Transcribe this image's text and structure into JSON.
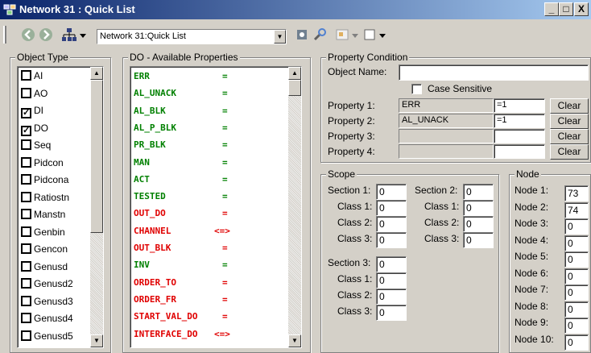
{
  "window": {
    "title": "Network 31 : Quick List",
    "minimize": "_",
    "maximize": "□",
    "close": "X"
  },
  "toolbar": {
    "combo_value": "Network 31:Quick List",
    "icons": [
      "back-icon",
      "forward-icon",
      "tree-icon",
      "dropdown-icon",
      "object-icon",
      "tool-icon",
      "page-icon",
      "window-icon"
    ]
  },
  "object_type": {
    "legend": "Object Type",
    "items": [
      {
        "label": "AI",
        "checked": false
      },
      {
        "label": "AO",
        "checked": false
      },
      {
        "label": "DI",
        "checked": true
      },
      {
        "label": "DO",
        "checked": true
      },
      {
        "label": "Seq",
        "checked": false
      },
      {
        "label": "Pidcon",
        "checked": false
      },
      {
        "label": "Pidcona",
        "checked": false
      },
      {
        "label": "Ratiostn",
        "checked": false
      },
      {
        "label": "Manstn",
        "checked": false
      },
      {
        "label": "Genbin",
        "checked": false
      },
      {
        "label": "Gencon",
        "checked": false
      },
      {
        "label": "Genusd",
        "checked": false
      },
      {
        "label": "Genusd2",
        "checked": false
      },
      {
        "label": "Genusd3",
        "checked": false
      },
      {
        "label": "Genusd4",
        "checked": false
      },
      {
        "label": "Genusd5",
        "checked": false
      }
    ],
    "check_mark": "✓"
  },
  "properties": {
    "legend": "DO - Available Properties",
    "colors": {
      "green": "#008000",
      "red": "#e00000"
    },
    "items": [
      {
        "name": "ERR",
        "op": "=",
        "color": "green"
      },
      {
        "name": "AL_UNACK",
        "op": "=",
        "color": "green"
      },
      {
        "name": "AL_BLK",
        "op": "=",
        "color": "green"
      },
      {
        "name": "AL_P_BLK",
        "op": "=",
        "color": "green"
      },
      {
        "name": "PR_BLK",
        "op": "=",
        "color": "green"
      },
      {
        "name": "MAN",
        "op": "=",
        "color": "green"
      },
      {
        "name": "ACT",
        "op": "=",
        "color": "green"
      },
      {
        "name": "TESTED",
        "op": "=",
        "color": "green"
      },
      {
        "name": "OUT_DO",
        "op": "=",
        "color": "red"
      },
      {
        "name": "CHANNEL",
        "op": "<=>",
        "color": "red"
      },
      {
        "name": "OUT_BLK",
        "op": "=",
        "color": "red"
      },
      {
        "name": "INV",
        "op": "=",
        "color": "green"
      },
      {
        "name": "ORDER_TO",
        "op": "=",
        "color": "red"
      },
      {
        "name": "ORDER_FR",
        "op": "=",
        "color": "red"
      },
      {
        "name": "START_VAL_DO",
        "op": "=",
        "color": "red"
      },
      {
        "name": "INTERFACE_DO",
        "op": "<=>",
        "color": "red"
      }
    ]
  },
  "condition": {
    "legend": "Property Condition",
    "object_name_label": "Object Name:",
    "object_name_value": "",
    "case_sensitive_label": "Case Sensitive",
    "clear_label": "Clear",
    "rows": [
      {
        "label": "Property 1:",
        "name": "ERR",
        "value": "=1"
      },
      {
        "label": "Property 2:",
        "name": "AL_UNACK",
        "value": "=1"
      },
      {
        "label": "Property 3:",
        "name": "",
        "value": ""
      },
      {
        "label": "Property 4:",
        "name": "",
        "value": ""
      }
    ]
  },
  "scope": {
    "legend": "Scope",
    "section1": {
      "label": "Section 1:",
      "value": "0",
      "classes": [
        {
          "label": "Class 1:",
          "value": "0"
        },
        {
          "label": "Class 2:",
          "value": "0"
        },
        {
          "label": "Class 3:",
          "value": "0"
        }
      ]
    },
    "section2": {
      "label": "Section 2:",
      "value": "0",
      "classes": [
        {
          "label": "Class 1:",
          "value": "0"
        },
        {
          "label": "Class 2:",
          "value": "0"
        },
        {
          "label": "Class 3:",
          "value": "0"
        }
      ]
    },
    "section3": {
      "label": "Section 3:",
      "value": "0",
      "classes": [
        {
          "label": "Class 1:",
          "value": "0"
        },
        {
          "label": "Class 2:",
          "value": "0"
        },
        {
          "label": "Class 3:",
          "value": "0"
        }
      ]
    }
  },
  "node": {
    "legend": "Node",
    "items": [
      {
        "label": "Node 1:",
        "value": "73"
      },
      {
        "label": "Node 2:",
        "value": "74"
      },
      {
        "label": "Node 3:",
        "value": "0"
      },
      {
        "label": "Node 4:",
        "value": "0"
      },
      {
        "label": "Node 5:",
        "value": "0"
      },
      {
        "label": "Node 6:",
        "value": "0"
      },
      {
        "label": "Node 7:",
        "value": "0"
      },
      {
        "label": "Node 8:",
        "value": "0"
      },
      {
        "label": "Node 9:",
        "value": "0"
      },
      {
        "label": "Node 10:",
        "value": "0"
      }
    ]
  }
}
